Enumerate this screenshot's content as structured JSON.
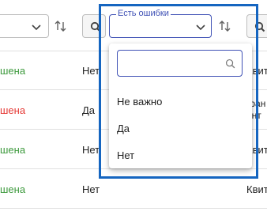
{
  "filter": {
    "label": "Есть ошибки",
    "search_placeholder": ""
  },
  "options": [
    "Не важно",
    "Да",
    "Нет"
  ],
  "rows": [
    {
      "status": "шена",
      "status_color": "green",
      "error": "Нет",
      "type": "Квит"
    },
    {
      "status": "шена",
      "status_color": "red",
      "error": "Да",
      "type_line1": "гран",
      "type_line2": "онт"
    },
    {
      "status": "шена",
      "status_color": "green",
      "error": "Нет",
      "type": "Квит"
    },
    {
      "status": "шена",
      "status_color": "green",
      "error": "Нет",
      "type": "Квит"
    }
  ],
  "colors": {
    "accent": "#3f51b5",
    "focus_frame": "#1565c0",
    "green": "#3d9a3d",
    "red": "#e53935"
  },
  "icons": [
    "chevron-down-icon",
    "sort-icon",
    "search-icon"
  ]
}
